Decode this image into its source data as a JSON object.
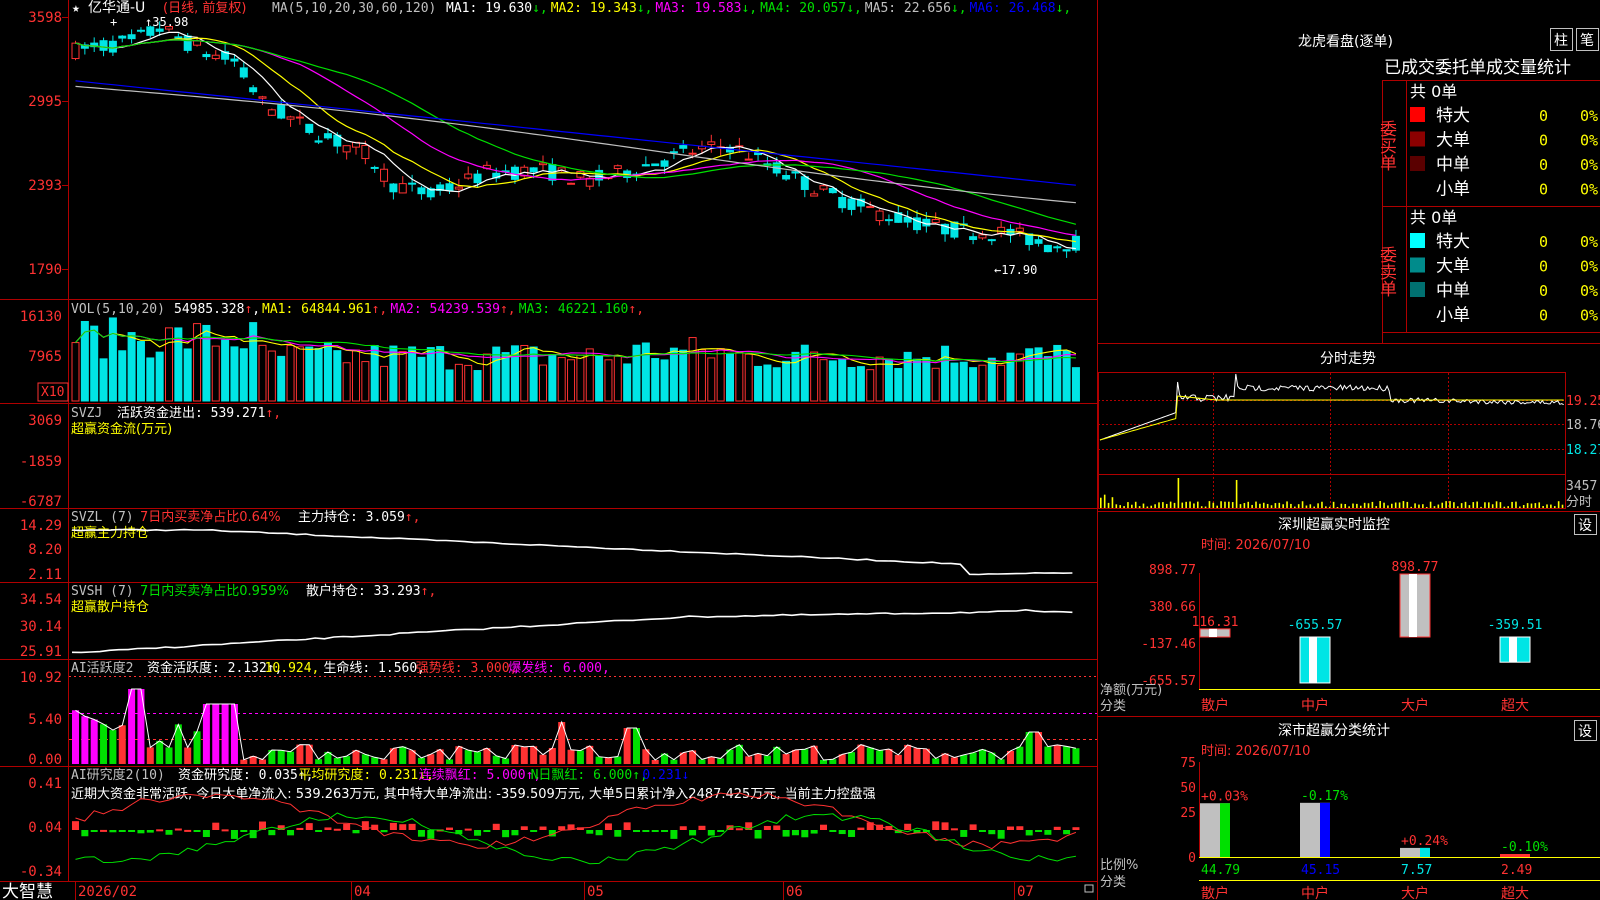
{
  "colors": {
    "up": "#ff3232",
    "down": "#00e5e5",
    "ma1": "#ffffff",
    "ma2": "#ffff00",
    "ma3": "#ff00ff",
    "ma4": "#00e000",
    "ma5": "#c0c0c0",
    "ma6": "#0000ff",
    "frame": "#b00000",
    "grid": "#5a0000"
  },
  "main": {
    "stock_name": "亿华通-U",
    "period": "(日线, 前复权)",
    "ma_header": "MA(5,10,20,30,60,120)",
    "ma": [
      {
        "name": "MA1:",
        "value": "19.630",
        "arrow": "↓"
      },
      {
        "name": "MA2:",
        "value": "19.343",
        "arrow": "↓"
      },
      {
        "name": "MA3:",
        "value": "19.583",
        "arrow": "↓"
      },
      {
        "name": "MA4:",
        "value": "20.057",
        "arrow": "↓"
      },
      {
        "name": "MA5:",
        "value": "22.656",
        "arrow": "↓"
      },
      {
        "name": "MA6:",
        "value": "26.468",
        "arrow": "↓"
      }
    ],
    "yticks": [
      "3598",
      "2995",
      "2393",
      "1790"
    ],
    "high_label": "35.98",
    "low_label": "17.90",
    "star": "★",
    "plus": "+"
  },
  "vol": {
    "header": "VOL(5,10,20)",
    "value": "54985.328",
    "arrow": "↑",
    "ma": [
      {
        "name": "MA1:",
        "value": "64844.961",
        "arrow": "↑"
      },
      {
        "name": "MA2:",
        "value": "54239.539",
        "arrow": "↑"
      },
      {
        "name": "MA3:",
        "value": "46221.160",
        "arrow": "↑"
      }
    ],
    "yticks": [
      "16130",
      "7965"
    ],
    "unit": "X10"
  },
  "svzj": {
    "header": "SVZJ",
    "label": "活跃资金进出:",
    "value": "539.271",
    "arrow": "↑,",
    "subtitle": "超赢资金流(万元)",
    "yticks": [
      "3069",
      "-1859",
      "-6787"
    ]
  },
  "svzl": {
    "header": "SVZL (7)",
    "stat": "7日内买卖净占比0.64%",
    "label": "主力持仓:",
    "value": "3.059",
    "arrow": "↑,",
    "subtitle": "超赢主力持仓",
    "yticks": [
      "14.29",
      "8.20",
      "2.11"
    ]
  },
  "svsh": {
    "header": "SVSH (7)",
    "stat": "7日内买卖净占比0.959%",
    "label": "散户持仓:",
    "value": "33.293",
    "arrow": "↑,",
    "subtitle": "超赢散户持仓",
    "yticks": [
      "34.54",
      "30.14",
      "25.91"
    ]
  },
  "ai1": {
    "header": "AI活跃度2",
    "items": [
      {
        "t": "资金活跃度:",
        "v": "2.132",
        "a": "↑,"
      },
      {
        "t": "",
        "v": "10.924",
        "a": ","
      },
      {
        "t": "生命线:",
        "v": "1.560",
        "a": ","
      },
      {
        "t": "强势线:",
        "v": "3.000",
        "a": ","
      },
      {
        "t": "爆发线:",
        "v": "6.000",
        "a": ","
      }
    ],
    "yticks": [
      "10.92",
      "5.40",
      "0.00"
    ]
  },
  "ai2": {
    "header": "AI研究度2(10)",
    "items": [
      {
        "t": "资金研究度:",
        "v": "0.035",
        "a": "↑,"
      },
      {
        "t": "平均研究度:",
        "v": "0.231",
        "a": "↓,"
      },
      {
        "t": "连续飘红:",
        "v": "5.000",
        "a": "↑,"
      },
      {
        "t": "N日飘红:",
        "v": "6.000",
        "a": "↑,"
      },
      {
        "t": "",
        "v": "0.231",
        "a": "↓"
      }
    ],
    "comment": "近期大资金非常活跃, 今日大单净流入: 539.263万元, 其中特大单净流出: -359.509万元, 大单5日累计净入2487.425万元, 当前主力控盘强",
    "yticks": [
      "0.41",
      "0.04",
      "-0.34"
    ]
  },
  "bottom": {
    "brand": "大智慧",
    "dates": [
      "2026/02",
      "04",
      "05",
      "06",
      "07"
    ]
  },
  "dragon": {
    "title": "龙虎看盘(逐单)",
    "btn1": "柱",
    "btn2": "笔",
    "subtitle": "已成交委托单成交量统计",
    "buy": {
      "side": "委买单",
      "total": "共 0单",
      "rows": [
        {
          "label": "特大",
          "count": "0",
          "pct": "0%",
          "color": "#ff0000"
        },
        {
          "label": "大单",
          "count": "0",
          "pct": "0%",
          "color": "#8b0000"
        },
        {
          "label": "中单",
          "count": "0",
          "pct": "0%",
          "color": "#5a0000"
        },
        {
          "label": "小单",
          "count": "0",
          "pct": "0%",
          "color": "#000000"
        }
      ]
    },
    "sell": {
      "side": "委卖单",
      "total": "共 0单",
      "rows": [
        {
          "label": "特大",
          "count": "0",
          "pct": "0%",
          "color": "#00ffff"
        },
        {
          "label": "大单",
          "count": "0",
          "pct": "0%",
          "color": "#008b8b"
        },
        {
          "label": "中单",
          "count": "0",
          "pct": "0%",
          "color": "#007070"
        },
        {
          "label": "小单",
          "count": "0",
          "pct": "0%",
          "color": "#000000"
        }
      ]
    }
  },
  "intraday": {
    "title": "分时走势",
    "prices": [
      "19.25",
      "18.76",
      "18.27"
    ],
    "vol": "3457",
    "vol_label": "分时"
  },
  "sz_monitor": {
    "title": "深圳超赢实时监控",
    "btn": "设",
    "time": "时间: 2026/07/10",
    "yticks": [
      "898.77",
      "380.66",
      "-137.46",
      "-655.57"
    ],
    "values": [
      116.31,
      -655.57,
      898.77,
      -359.51
    ],
    "value_labels": [
      "116.31",
      "-655.57",
      "898.77",
      "-359.51"
    ],
    "categories": [
      "散户",
      "中户",
      "大户",
      "超大"
    ],
    "axis_label": "净额(万元)",
    "axis_label2": "分类"
  },
  "sz_stat": {
    "title": "深市超赢分类统计",
    "btn": "设",
    "time": "时间: 2026/07/10",
    "yticks": [
      "75",
      "50",
      "25",
      "0"
    ],
    "values": [
      44.79,
      45.15,
      7.57,
      2.49
    ],
    "value_labels": [
      "44.79",
      "45.15",
      "7.57",
      "2.49"
    ],
    "changes": [
      "+0.03%",
      "-0.17%",
      "+0.24%",
      "-0.10%"
    ],
    "categories": [
      "散户",
      "中户",
      "大户",
      "超大"
    ],
    "axis_label": "比例%",
    "axis_label2": "分类"
  }
}
